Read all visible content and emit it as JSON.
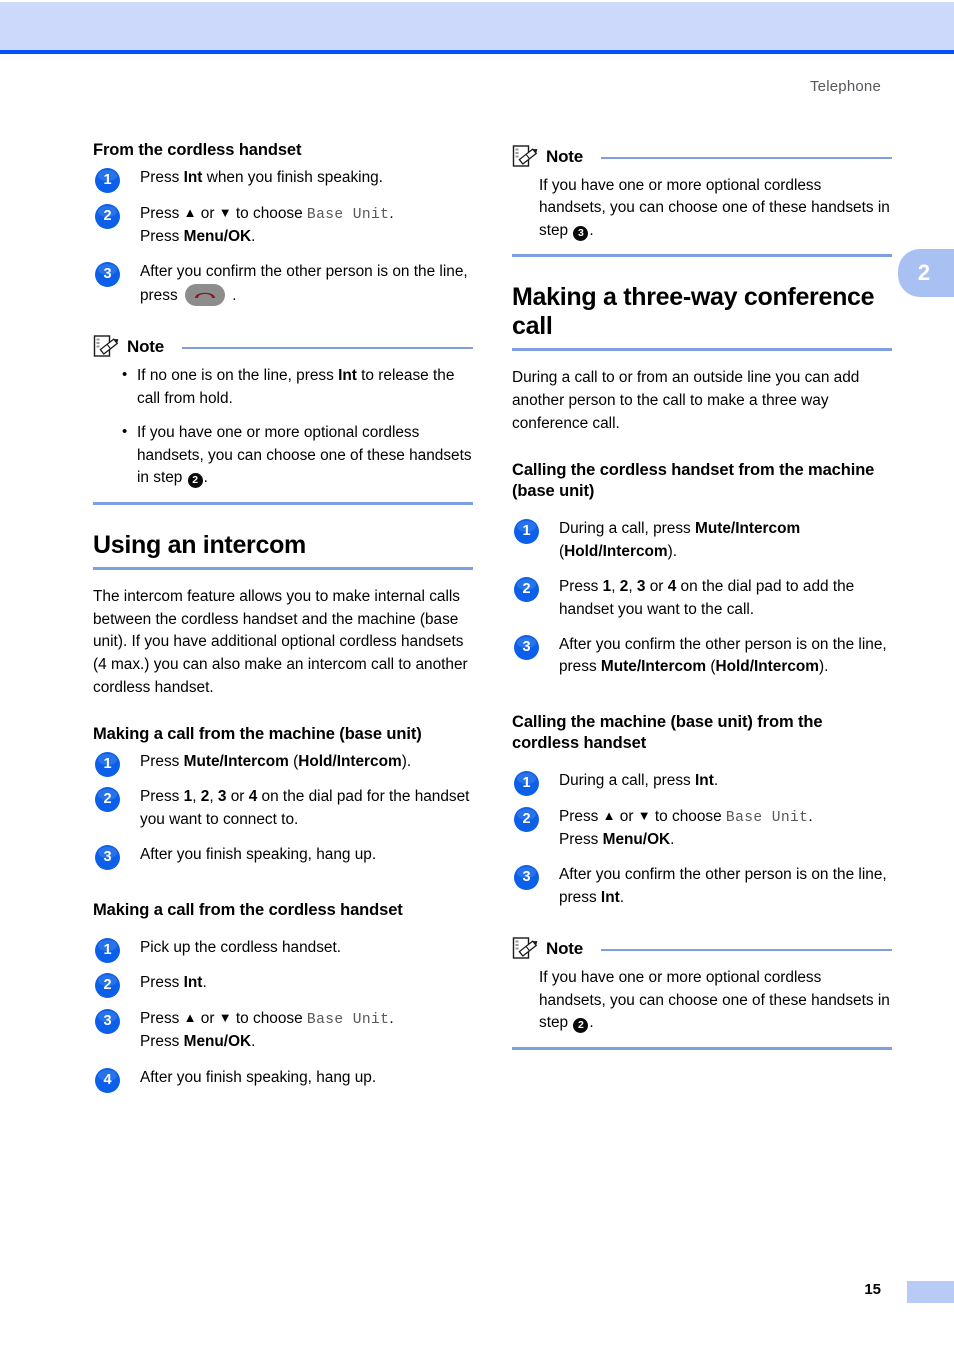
{
  "header": {
    "running_head": "Telephone",
    "band_color": "#ccd9fb",
    "rule_color": "#0052ff"
  },
  "thumb_tab": {
    "label": "2",
    "color": "#a9c0f2"
  },
  "footer": {
    "page_number": "15",
    "block_color": "#b8cbf6"
  },
  "rule_color": "#7e9fe0",
  "icons": {
    "note": "note-pencil-icon",
    "hangup": "hangup-handset-icon"
  },
  "left_column": {
    "heading_from_cordless": "From the cordless handset",
    "steps_from_cordless": [
      {
        "num": "1",
        "html": "Press <b>Int</b> when you finish speaking."
      },
      {
        "num": "2",
        "html": "Press <span class=\"arrow\">▲</span> or <span class=\"arrow\">▼</span> to choose <span class=\"mono\">Base Unit</span>.<br>Press <b>Menu/OK</b>."
      },
      {
        "num": "3",
        "html": "After you confirm the other person is on the line, press <span class=\"keycap\" data-name=\"hangup-key-icon\"><svg width=\"24\" height=\"12\" viewBox=\"0 0 24 12\"><path d=\"M2 9 C2 2, 22 2, 22 9 L19 9 C19 6.2 15.8 5 12 5 C8.2 5 5 6.2 5 9 Z\" fill=\"#8d1128\"/></svg></span> ."
      }
    ],
    "note1": {
      "title": "Note",
      "bullets": [
        "If no one is on the line, press <b>Int</b> to release the call from hold.",
        "If you have one or more optional cordless handsets, you can choose one of these handsets in step <span class=\"ref\">2</span>."
      ]
    },
    "section_heading": "Using an intercom",
    "section_paragraph": "The intercom feature allows you to make internal calls between the cordless handset and the machine (base unit). If you have additional optional cordless handsets (4 max.) you can also make an intercom call to another cordless handset.",
    "heading_call_from_machine": "Making a call from the machine (base unit)",
    "steps_call_from_machine": [
      {
        "num": "1",
        "html": "Press <b>Mute/Intercom</b> (<b>Hold/Intercom</b>)."
      },
      {
        "num": "2",
        "html": "Press <b>1</b>, <b>2</b>, <b>3</b> or <b>4</b> on the dial pad for the handset you want to connect to."
      },
      {
        "num": "3",
        "html": "After you finish speaking, hang up."
      }
    ],
    "heading_call_from_cordless": "Making a call from the cordless handset",
    "steps_call_from_cordless": [
      {
        "num": "1",
        "html": "Pick up the cordless handset."
      },
      {
        "num": "2",
        "html": "Press <b>Int</b>."
      },
      {
        "num": "3",
        "html": "Press <span class=\"arrow\">▲</span> or <span class=\"arrow\">▼</span> to choose <span class=\"mono\">Base Unit</span>.<br>Press <b>Menu/OK</b>."
      },
      {
        "num": "4",
        "html": "After you finish speaking, hang up."
      }
    ]
  },
  "right_column": {
    "note_top": {
      "title": "Note",
      "paragraphs": [
        "If you have one or more optional cordless handsets, you can choose one of these handsets in step <span class=\"ref\">3</span>."
      ]
    },
    "section_heading": "Making a three-way conference call",
    "section_paragraph": "During a call to or from an outside line you can add another person to the call to make a three way conference call.",
    "heading_calling_cordless": "Calling the cordless handset from the machine (base unit)",
    "steps_calling_cordless": [
      {
        "num": "1",
        "html": "During a call, press <b>Mute/Intercom</b> (<b>Hold/Intercom</b>)."
      },
      {
        "num": "2",
        "html": "Press <b>1</b>, <b>2</b>, <b>3</b> or <b>4</b> on the dial pad to add the handset you want to the call."
      },
      {
        "num": "3",
        "html": "After you confirm the other person is on the line, press <b>Mute/Intercom</b> (<b>Hold/Intercom</b>)."
      }
    ],
    "heading_calling_machine": "Calling the machine (base unit) from the cordless handset",
    "steps_calling_machine": [
      {
        "num": "1",
        "html": "During a call, press <b>Int</b>."
      },
      {
        "num": "2",
        "html": "Press <span class=\"arrow\">▲</span> or <span class=\"arrow\">▼</span> to choose <span class=\"mono\">Base Unit</span>.<br>Press <b>Menu/OK</b>."
      },
      {
        "num": "3",
        "html": "After you confirm the other person is on the line, press <b>Int</b>."
      }
    ],
    "note_bottom": {
      "title": "Note",
      "paragraphs": [
        "If you have one or more optional cordless handsets, you can choose one of these handsets in step <span class=\"ref\">2</span>."
      ]
    }
  }
}
